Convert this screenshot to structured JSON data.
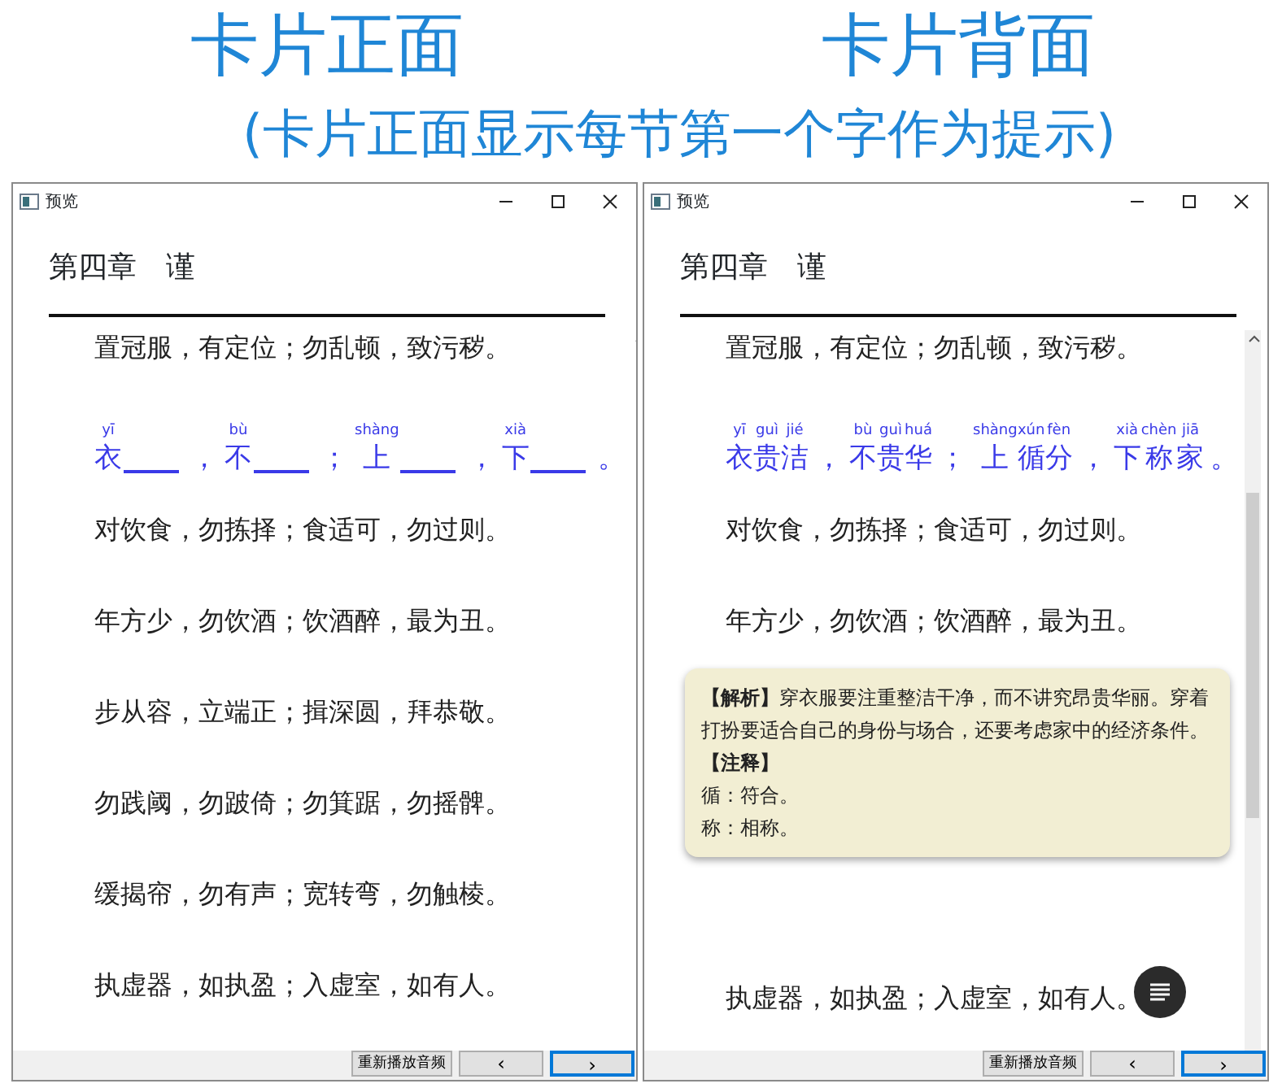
{
  "captions": [
    {
      "text": "卡片正面"
    },
    {
      "text": "卡片背面"
    }
  ],
  "subtitle": "(卡片正面显示每节第一个字作为提示)",
  "windows": [
    {
      "title": "预览",
      "heading": "第四章　谨",
      "lines": [
        {
          "kind": "text",
          "text": "置冠服，有定位；勿乱顿，致污秽。"
        },
        {
          "kind": "ruby",
          "segments": [
            {
              "kind": "ruby",
              "base": "衣",
              "ruby": "yī"
            },
            {
              "kind": "blank"
            },
            {
              "kind": "punct",
              "text": "，"
            },
            {
              "kind": "ruby",
              "base": "不",
              "ruby": "bù"
            },
            {
              "kind": "blank"
            },
            {
              "kind": "punct",
              "text": "；"
            },
            {
              "kind": "ruby",
              "base": "上",
              "ruby": "shàng"
            },
            {
              "kind": "blank"
            },
            {
              "kind": "punct",
              "text": "，"
            },
            {
              "kind": "ruby",
              "base": "下",
              "ruby": "xià"
            },
            {
              "kind": "blank"
            },
            {
              "kind": "punct",
              "text": "。"
            }
          ]
        },
        {
          "kind": "text",
          "text": "对饮食，勿拣择；食适可，勿过则。"
        },
        {
          "kind": "text",
          "text": "年方少，勿饮酒；饮酒醉，最为丑。"
        },
        {
          "kind": "text",
          "text": "步从容，立端正；揖深圆，拜恭敬。"
        },
        {
          "kind": "text",
          "text": "勿践阈，勿跛倚；勿箕踞，勿摇髀。"
        },
        {
          "kind": "text",
          "text": "缓揭帘，勿有声；宽转弯，勿触棱。"
        },
        {
          "kind": "text",
          "text": "执虚器，如执盈；入虚室，如有人。"
        }
      ],
      "buttons": [
        {
          "label": "重新播放音频",
          "focused": false
        },
        {
          "label": "‹",
          "focused": false
        },
        {
          "label": "›",
          "focused": true
        }
      ]
    },
    {
      "title": "预览",
      "heading": "第四章　谨",
      "lines": [
        {
          "kind": "text",
          "text": "置冠服，有定位；勿乱顿，致污秽。"
        },
        {
          "kind": "ruby",
          "segments": [
            {
              "kind": "ruby",
              "base": "衣",
              "ruby": "yī"
            },
            {
              "kind": "ruby",
              "base": "贵",
              "ruby": "guì"
            },
            {
              "kind": "ruby",
              "base": "洁",
              "ruby": "jié"
            },
            {
              "kind": "punct",
              "text": "，"
            },
            {
              "kind": "ruby",
              "base": "不",
              "ruby": "bù"
            },
            {
              "kind": "ruby",
              "base": "贵",
              "ruby": "guì"
            },
            {
              "kind": "ruby",
              "base": "华",
              "ruby": "huá"
            },
            {
              "kind": "punct",
              "text": "；"
            },
            {
              "kind": "ruby",
              "base": "上",
              "ruby": "shàng"
            },
            {
              "kind": "ruby",
              "base": "循",
              "ruby": "xún"
            },
            {
              "kind": "ruby",
              "base": "分",
              "ruby": "fèn"
            },
            {
              "kind": "punct",
              "text": "，"
            },
            {
              "kind": "ruby",
              "base": "下",
              "ruby": "xià"
            },
            {
              "kind": "ruby",
              "base": "称",
              "ruby": "chèn"
            },
            {
              "kind": "ruby",
              "base": "家",
              "ruby": "jiā"
            },
            {
              "kind": "punct",
              "text": "。"
            }
          ]
        },
        {
          "kind": "text",
          "text": "对饮食，勿拣择；食适可，勿过则。"
        },
        {
          "kind": "text",
          "text": "年方少，勿饮酒；饮酒醉，最为丑。"
        },
        {
          "kind": "popup",
          "paragraphs": [
            {
              "kind": "text",
              "text": "**【解析】**穿衣服要注重整洁干净，而不讲究昂贵华丽。穿着打扮要适合自己的身份与场合，还要考虑家中的经济条件。"
            },
            {
              "kind": "heading",
              "text": "【注释】"
            },
            {
              "kind": "text",
              "text": "循：符合。"
            },
            {
              "kind": "text",
              "text": "称：相称。"
            }
          ]
        },
        {
          "kind": "text",
          "text": "执虚器，如执盈；入虚室，如有人。"
        }
      ],
      "menu_button": true,
      "buttons": [
        {
          "label": "重新播放音频",
          "focused": false
        },
        {
          "label": "‹",
          "focused": false
        },
        {
          "label": "›",
          "focused": true
        }
      ]
    }
  ]
}
